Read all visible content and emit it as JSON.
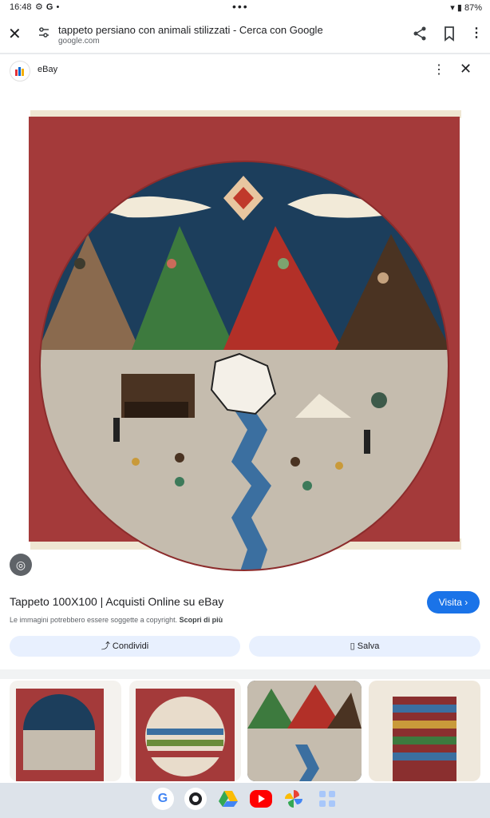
{
  "status_bar": {
    "time": "16:48",
    "left_icons": [
      "gear-icon",
      "google-g-icon",
      "dot-icon"
    ],
    "battery": "87%"
  },
  "header": {
    "title": "tappeto persiano con animali stilizzati - Cerca con Google",
    "domain": "google.com"
  },
  "source": {
    "name": "eBay"
  },
  "result": {
    "title": "Tappeto 100X100 | Acquisti Online su eBay",
    "visit_label": "Visita",
    "copyright": "Le immagini potrebbero essere soggette a copyright.",
    "learn_more": "Scopri di più",
    "share_label": "Condividi",
    "save_label": "Salva"
  },
  "colors": {
    "accent": "#1a73e8",
    "rug_border": "#a43a3a",
    "rug_sky": "#1c3e5c",
    "chip_bg": "#e8f0fe"
  },
  "dock": {
    "apps": [
      "google-icon",
      "camera-icon",
      "drive-icon",
      "youtube-icon",
      "photos-icon",
      "app-drawer-icon"
    ]
  }
}
